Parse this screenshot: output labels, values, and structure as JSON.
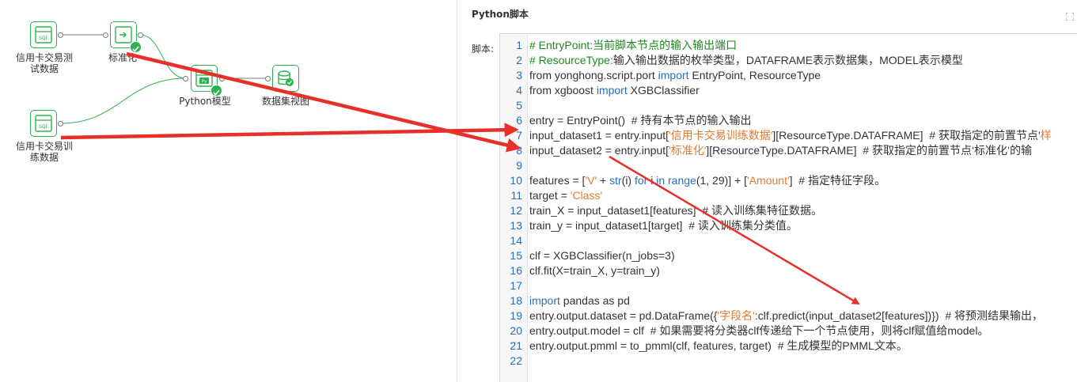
{
  "flow": {
    "nodes": [
      {
        "id": "sql1",
        "label_lines": [
          "信用卡交易测",
          "试数据"
        ],
        "icon": "sql-icon",
        "checked": false
      },
      {
        "id": "std",
        "label_lines": [
          "标准化"
        ],
        "icon": "transform-icon",
        "checked": true
      },
      {
        "id": "py",
        "label_lines": [
          "Python模型"
        ],
        "icon": "python-icon",
        "checked": true
      },
      {
        "id": "view",
        "label_lines": [
          "数据集视图"
        ],
        "icon": "dataset-view-icon",
        "checked": false
      },
      {
        "id": "sql2",
        "label_lines": [
          "信用卡交易训",
          "练数据"
        ],
        "icon": "sql-icon",
        "checked": false
      }
    ],
    "accent_color": "#2ab34e",
    "arrow_color": "#e8302a"
  },
  "panel": {
    "title": "Python脚本",
    "script_label": "脚本:"
  },
  "code": {
    "lines": [
      {
        "n": "1",
        "tokens": [
          {
            "t": "# EntryPoint:当前脚本节点的输入输出端口",
            "c": "comment"
          }
        ]
      },
      {
        "n": "2",
        "tokens": [
          {
            "t": "# ResourceType:",
            "c": "comment"
          },
          {
            "t": "输入输出数据的枚举类型，DATAFRAME表示数据集，MODEL表示模型",
            "c": "plain"
          }
        ]
      },
      {
        "n": "3",
        "tokens": [
          {
            "t": "from yonghong.script.port ",
            "c": "plain"
          },
          {
            "t": "import",
            "c": "keyword"
          },
          {
            "t": " EntryPoint, ResourceType",
            "c": "plain"
          }
        ]
      },
      {
        "n": "4",
        "tokens": [
          {
            "t": "from xgboost ",
            "c": "plain"
          },
          {
            "t": "import",
            "c": "keyword"
          },
          {
            "t": " XGBClassifier",
            "c": "plain"
          }
        ]
      },
      {
        "n": "5",
        "tokens": []
      },
      {
        "n": "6",
        "tokens": [
          {
            "t": "entry = EntryPoint()  # 持有本节点的输入输出",
            "c": "plain"
          }
        ]
      },
      {
        "n": "7",
        "tokens": [
          {
            "t": "input_dataset1 = entry.input[",
            "c": "plain"
          },
          {
            "t": "'信用卡交易训练数据'",
            "c": "string"
          },
          {
            "t": "][ResourceType.DATAFRAME]  # 获取指定的前置节点'",
            "c": "plain"
          },
          {
            "t": "样",
            "c": "string"
          }
        ]
      },
      {
        "n": "8",
        "tokens": [
          {
            "t": "input_dataset2 = entry.input[",
            "c": "plain"
          },
          {
            "t": "'标准化'",
            "c": "string"
          },
          {
            "t": "][ResourceType.DATAFRAME]  # 获取指定的前置节点‘标准化’的输",
            "c": "plain"
          }
        ]
      },
      {
        "n": "9",
        "tokens": []
      },
      {
        "n": "10",
        "tokens": [
          {
            "t": "features = [",
            "c": "plain"
          },
          {
            "t": "'V'",
            "c": "string"
          },
          {
            "t": " + ",
            "c": "plain"
          },
          {
            "t": "str",
            "c": "keyword"
          },
          {
            "t": "(i) ",
            "c": "plain"
          },
          {
            "t": "for",
            "c": "keyword"
          },
          {
            "t": " i ",
            "c": "plain"
          },
          {
            "t": "in",
            "c": "keyword"
          },
          {
            "t": " ",
            "c": "plain"
          },
          {
            "t": "range",
            "c": "keyword"
          },
          {
            "t": "(1, 29)] + [",
            "c": "plain"
          },
          {
            "t": "'Amount'",
            "c": "string"
          },
          {
            "t": "]  # 指定特征字段。",
            "c": "plain"
          }
        ]
      },
      {
        "n": "11",
        "tokens": [
          {
            "t": "target = ",
            "c": "plain"
          },
          {
            "t": "'Class'",
            "c": "string"
          }
        ]
      },
      {
        "n": "12",
        "tokens": [
          {
            "t": "train_X = input_dataset1[features]  # 读入训练集特征数据。",
            "c": "plain"
          }
        ]
      },
      {
        "n": "13",
        "tokens": [
          {
            "t": "train_y = input_dataset1[target]  # 读入训练集分类值。",
            "c": "plain"
          }
        ]
      },
      {
        "n": "14",
        "tokens": []
      },
      {
        "n": "15",
        "tokens": [
          {
            "t": "clf = XGBClassifier(n_jobs=3)",
            "c": "plain"
          }
        ]
      },
      {
        "n": "16",
        "tokens": [
          {
            "t": "clf.fit(X=train_X, y=train_y)",
            "c": "plain"
          }
        ]
      },
      {
        "n": "17",
        "tokens": []
      },
      {
        "n": "18",
        "tokens": [
          {
            "t": "import",
            "c": "keyword"
          },
          {
            "t": " pandas as pd",
            "c": "plain"
          }
        ]
      },
      {
        "n": "19",
        "tokens": [
          {
            "t": "entry.output.dataset = pd.DataFrame({",
            "c": "plain"
          },
          {
            "t": "'字段名'",
            "c": "string"
          },
          {
            "t": ":clf.predict(input_dataset2[features])})  # 将预测结果输出，",
            "c": "plain"
          }
        ]
      },
      {
        "n": "20",
        "tokens": [
          {
            "t": "entry.output.model = clf  # 如果需要将分类器clf传递给下一个节点使用，则将clf赋值给model。",
            "c": "plain"
          }
        ]
      },
      {
        "n": "21",
        "tokens": [
          {
            "t": "entry.output.pmml = to_pmml(clf, features, target)  # 生成模型的PMML文本。",
            "c": "plain"
          }
        ]
      },
      {
        "n": "22",
        "tokens": []
      }
    ]
  }
}
